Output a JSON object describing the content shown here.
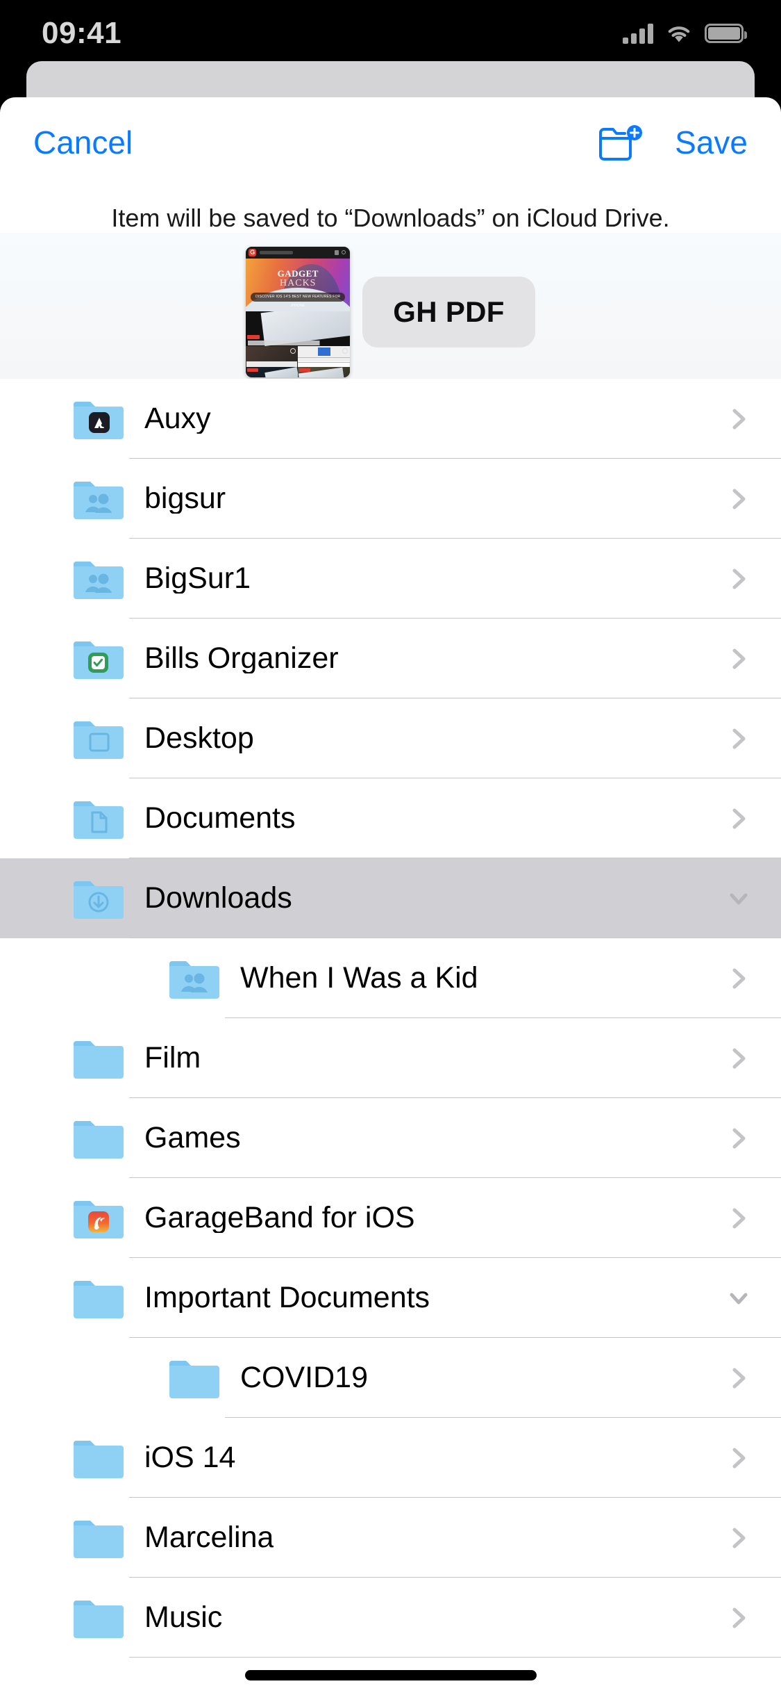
{
  "status_bar": {
    "time": "09:41",
    "cellular_icon": "signal-bars-icon",
    "wifi_icon": "wifi-icon",
    "battery_icon": "battery-icon"
  },
  "sheet": {
    "cancel_label": "Cancel",
    "save_label": "Save",
    "new_folder_icon": "new-folder-icon",
    "subtitle": "Item will be saved to “Downloads” on iCloud Drive.",
    "preview": {
      "thumbnail_alt": "GADGET HACKS webpage screenshot",
      "thumbnail_title_line1": "GADGET",
      "thumbnail_title_line2": "HACKS",
      "thumbnail_banner": "DISCOVER IOS 14'S BEST NEW FEATURES FOR IPHONE",
      "filename": "GH PDF"
    }
  },
  "colors": {
    "accent_blue": "#0a7aff",
    "folder_blue": "#8fd0f5",
    "selected_row": "#cfcfd4",
    "separator": "#c6c6c8",
    "chevron_gray": "#c4c4c6",
    "status_text": "#d8d8d8"
  },
  "file_list": [
    {
      "label": "Auxy",
      "icon": "folder-app-auxy-icon",
      "indent": 0,
      "chevron": "chevron-right-icon",
      "selected": false
    },
    {
      "label": "bigsur",
      "icon": "folder-shared-icon",
      "indent": 0,
      "chevron": "chevron-right-icon",
      "selected": false
    },
    {
      "label": "BigSur1",
      "icon": "folder-shared-icon",
      "indent": 0,
      "chevron": "chevron-right-icon",
      "selected": false
    },
    {
      "label": "Bills Organizer",
      "icon": "folder-app-reminders-icon",
      "indent": 0,
      "chevron": "chevron-right-icon",
      "selected": false
    },
    {
      "label": "Desktop",
      "icon": "folder-desktop-icon",
      "indent": 0,
      "chevron": "chevron-right-icon",
      "selected": false
    },
    {
      "label": "Documents",
      "icon": "folder-documents-icon",
      "indent": 0,
      "chevron": "chevron-right-icon",
      "selected": false
    },
    {
      "label": "Downloads",
      "icon": "folder-downloads-icon",
      "indent": 0,
      "chevron": "chevron-down-icon",
      "selected": true
    },
    {
      "label": "When I Was a Kid",
      "icon": "folder-shared-icon",
      "indent": 1,
      "chevron": "chevron-right-icon",
      "selected": false
    },
    {
      "label": "Film",
      "icon": "folder-plain-icon",
      "indent": 0,
      "chevron": "chevron-right-icon",
      "selected": false
    },
    {
      "label": "Games",
      "icon": "folder-plain-icon",
      "indent": 0,
      "chevron": "chevron-right-icon",
      "selected": false
    },
    {
      "label": "GarageBand for iOS",
      "icon": "folder-app-garageband-icon",
      "indent": 0,
      "chevron": "chevron-right-icon",
      "selected": false
    },
    {
      "label": "Important Documents",
      "icon": "folder-plain-icon",
      "indent": 0,
      "chevron": "chevron-down-icon",
      "selected": false
    },
    {
      "label": "COVID19",
      "icon": "folder-plain-icon",
      "indent": 1,
      "chevron": "chevron-right-icon",
      "selected": false
    },
    {
      "label": "iOS 14",
      "icon": "folder-plain-icon",
      "indent": 0,
      "chevron": "chevron-right-icon",
      "selected": false
    },
    {
      "label": "Marcelina",
      "icon": "folder-plain-icon",
      "indent": 0,
      "chevron": "chevron-right-icon",
      "selected": false
    },
    {
      "label": "Music",
      "icon": "folder-plain-icon",
      "indent": 0,
      "chevron": "chevron-right-icon",
      "selected": false
    }
  ]
}
